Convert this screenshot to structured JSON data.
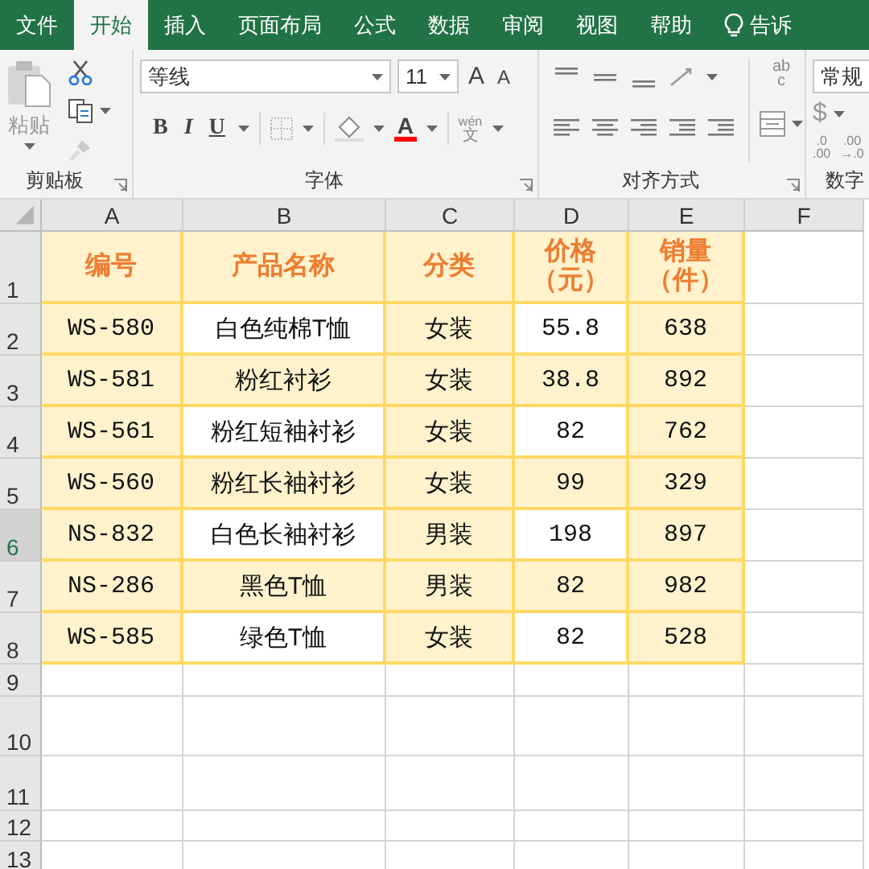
{
  "tabs": [
    {
      "label": "文件",
      "selected": false
    },
    {
      "label": "开始",
      "selected": true
    },
    {
      "label": "插入",
      "selected": false
    },
    {
      "label": "页面布局",
      "selected": false
    },
    {
      "label": "公式",
      "selected": false
    },
    {
      "label": "数据",
      "selected": false
    },
    {
      "label": "审阅",
      "selected": false
    },
    {
      "label": "视图",
      "selected": false
    },
    {
      "label": "帮助",
      "selected": false
    },
    {
      "label": "告诉",
      "selected": false,
      "kind": "tell"
    }
  ],
  "ribbon": {
    "clipboard": {
      "label": "剪贴板",
      "paste": "粘贴"
    },
    "font": {
      "label": "字体",
      "name": "等线",
      "size": "11",
      "grow": "A",
      "shrink": "A",
      "bold": "B",
      "italic": "I",
      "underline": "U",
      "color_letter": "A",
      "phonetic_top": "wén",
      "phonetic_bottom": "文"
    },
    "alignment": {
      "label": "对齐方式",
      "wrap_top": "ab",
      "wrap_bottom": "c"
    },
    "number": {
      "label": "数字",
      "format": "常规",
      "currency": "$",
      "decimals": [
        {
          "top": ".0",
          "bottom": ".00"
        },
        {
          "top": ".00",
          "bottom": "→.0"
        }
      ]
    }
  },
  "sheet": {
    "columns": [
      {
        "label": "A",
        "selected": false
      },
      {
        "label": "B",
        "selected": false
      },
      {
        "label": "C",
        "selected": false
      },
      {
        "label": "D",
        "selected": false
      },
      {
        "label": "E",
        "selected": false
      },
      {
        "label": "F",
        "selected": false
      }
    ],
    "rows": [
      {
        "number": "1",
        "selected": false,
        "kind": "header",
        "cells": [
          {
            "text": "编号",
            "filled": true
          },
          {
            "text": "产品名称",
            "filled": true
          },
          {
            "text": "分类",
            "filled": true
          },
          {
            "text": "价格（元）",
            "filled": true
          },
          {
            "text": "销量（件）",
            "filled": true
          }
        ]
      },
      {
        "number": "2",
        "selected": false,
        "kind": "data",
        "cells": [
          {
            "text": "WS-580",
            "filled": true
          },
          {
            "text": "白色纯棉T恤",
            "filled": false
          },
          {
            "text": "女装",
            "filled": true
          },
          {
            "text": "55.8",
            "filled": false
          },
          {
            "text": "638",
            "filled": true
          }
        ]
      },
      {
        "number": "3",
        "selected": false,
        "kind": "data",
        "cells": [
          {
            "text": "WS-581",
            "filled": true
          },
          {
            "text": "粉红衬衫",
            "filled": true
          },
          {
            "text": "女装",
            "filled": true
          },
          {
            "text": "38.8",
            "filled": true
          },
          {
            "text": "892",
            "filled": true
          }
        ]
      },
      {
        "number": "4",
        "selected": false,
        "kind": "data",
        "cells": [
          {
            "text": "WS-561",
            "filled": true
          },
          {
            "text": "粉红短袖衬衫",
            "filled": false
          },
          {
            "text": "女装",
            "filled": true
          },
          {
            "text": "82",
            "filled": false
          },
          {
            "text": "762",
            "filled": true
          }
        ]
      },
      {
        "number": "5",
        "selected": false,
        "kind": "data",
        "cells": [
          {
            "text": "WS-560",
            "filled": true
          },
          {
            "text": "粉红长袖衬衫",
            "filled": true
          },
          {
            "text": "女装",
            "filled": true
          },
          {
            "text": "99",
            "filled": true
          },
          {
            "text": "329",
            "filled": true
          }
        ]
      },
      {
        "number": "6",
        "selected": true,
        "kind": "data",
        "cells": [
          {
            "text": "NS-832",
            "filled": true
          },
          {
            "text": "白色长袖衬衫",
            "filled": false
          },
          {
            "text": "男装",
            "filled": true
          },
          {
            "text": "198",
            "filled": false
          },
          {
            "text": "897",
            "filled": true
          }
        ]
      },
      {
        "number": "7",
        "selected": false,
        "kind": "data",
        "cells": [
          {
            "text": "NS-286",
            "filled": true
          },
          {
            "text": "黑色T恤",
            "filled": true
          },
          {
            "text": "男装",
            "filled": true
          },
          {
            "text": "82",
            "filled": true
          },
          {
            "text": "982",
            "filled": true
          }
        ]
      },
      {
        "number": "8",
        "selected": false,
        "kind": "data",
        "cells": [
          {
            "text": "WS-585",
            "filled": true
          },
          {
            "text": "绿色T恤",
            "filled": false
          },
          {
            "text": "女装",
            "filled": true
          },
          {
            "text": "82",
            "filled": false
          },
          {
            "text": "528",
            "filled": true
          }
        ]
      },
      {
        "number": "9",
        "selected": false,
        "kind": "empty"
      },
      {
        "number": "10",
        "selected": false,
        "kind": "empty"
      },
      {
        "number": "11",
        "selected": false,
        "kind": "empty"
      },
      {
        "number": "12",
        "selected": false,
        "kind": "empty"
      },
      {
        "number": "13",
        "selected": false,
        "kind": "empty"
      }
    ]
  }
}
